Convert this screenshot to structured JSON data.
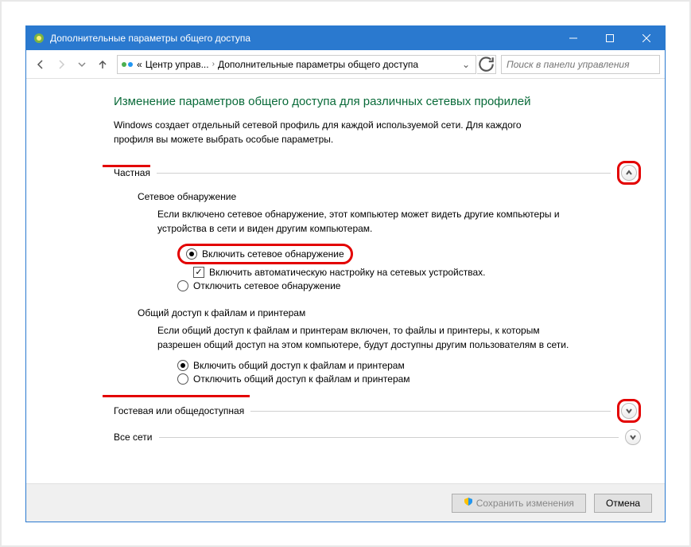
{
  "titlebar": {
    "title": "Дополнительные параметры общего доступа"
  },
  "navbar": {
    "breadcrumb": {
      "prefix": "«",
      "item1": "Центр управ...",
      "item2": "Дополнительные параметры общего доступа"
    },
    "search_placeholder": "Поиск в панели управления"
  },
  "page": {
    "title": "Изменение параметров общего доступа для различных сетевых профилей",
    "desc": "Windows создает отдельный сетевой профиль для каждой используемой сети. Для каждого профиля вы можете выбрать особые параметры."
  },
  "private": {
    "label": "Частная",
    "discovery": {
      "label": "Сетевое обнаружение",
      "desc": "Если включено сетевое обнаружение, этот компьютер может видеть другие компьютеры и устройства в сети и виден другим компьютерам.",
      "opt_on": "Включить сетевое обнаружение",
      "auto": "Включить автоматическую настройку на сетевых устройствах.",
      "opt_off": "Отключить сетевое обнаружение"
    },
    "sharing": {
      "label": "Общий доступ к файлам и принтерам",
      "desc": "Если общий доступ к файлам и принтерам включен, то файлы и принтеры, к которым разрешен общий доступ на этом компьютере, будут доступны другим пользователям в сети.",
      "opt_on": "Включить общий доступ к файлам и принтерам",
      "opt_off": "Отключить общий доступ к файлам и принтерам"
    }
  },
  "guest": {
    "label": "Гостевая или общедоступная"
  },
  "allnets": {
    "label": "Все сети"
  },
  "footer": {
    "save": "Сохранить изменения",
    "cancel": "Отмена"
  }
}
